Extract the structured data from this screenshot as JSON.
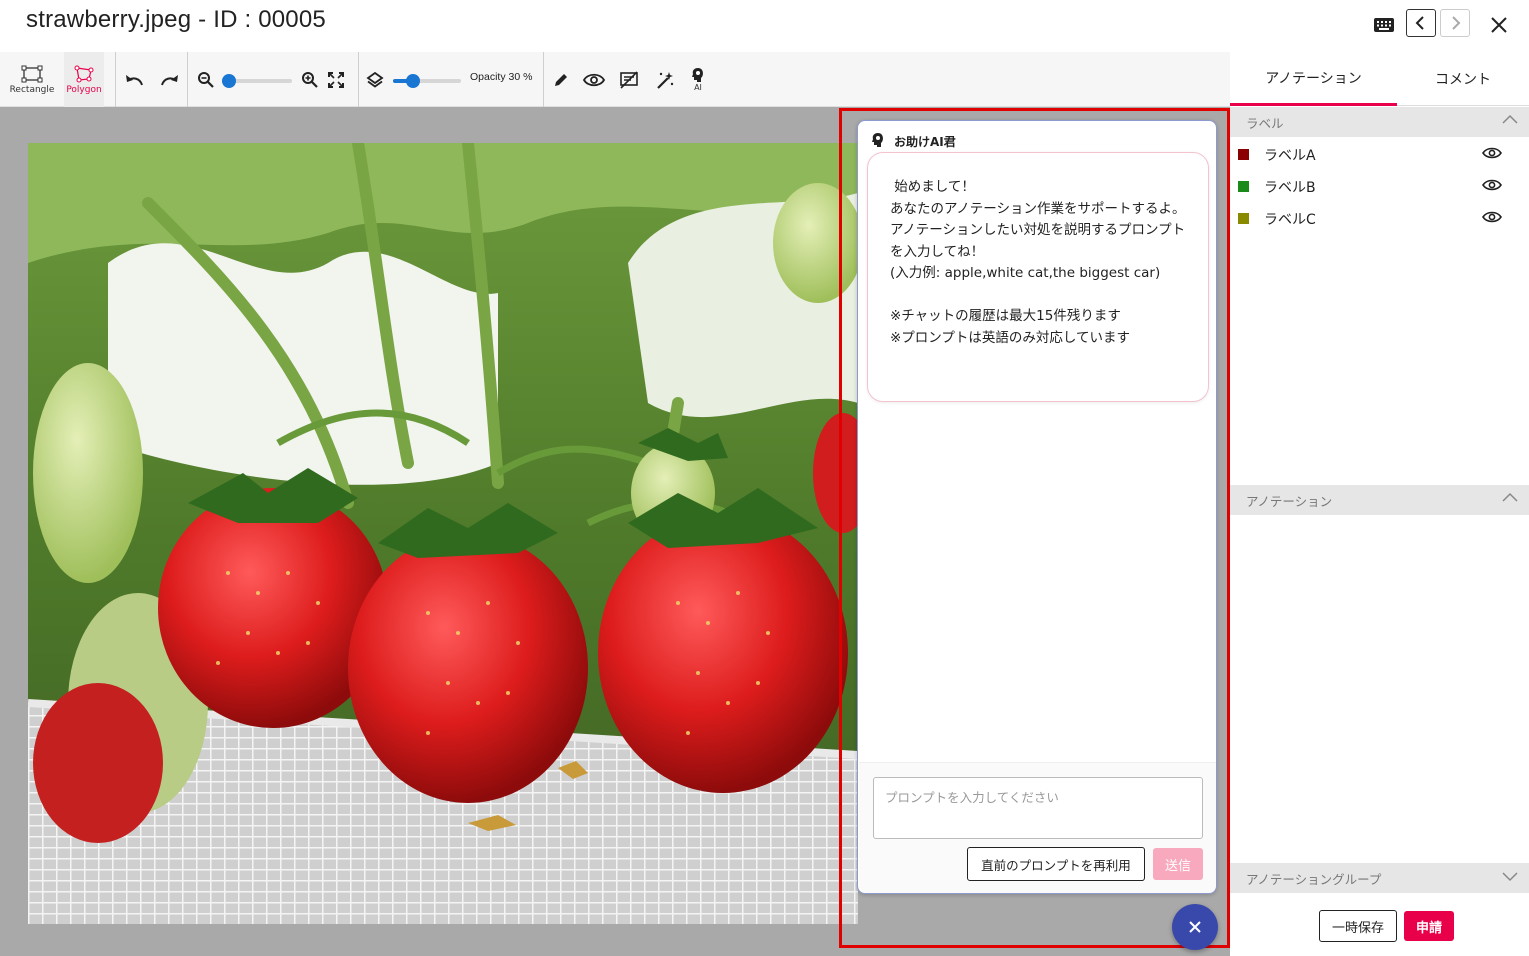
{
  "window": {
    "title": "strawberry.jpeg - ID : 00005"
  },
  "toolbar": {
    "rectangle_label": "Rectangle",
    "polygon_label": "Polygon",
    "opacity_label": "Opacity 30 %",
    "opacity_value": 0.3,
    "zoom_value": 0.05,
    "ai_label": "AI"
  },
  "chat": {
    "title": "お助けAI君",
    "message": " 始めまして！\nあなたのアノテーション作業をサポートするよ。\nアノテーションしたい対処を説明するプロンプトを入力してね！\n(入力例: apple,white cat,the biggest car)\n\n※チャットの履歴は最大15件残ります\n※プロンプトは英語のみ対応しています",
    "placeholder": "プロンプトを入力してください",
    "reuse_label": "直前のプロンプトを再利用",
    "send_label": "送信"
  },
  "sidebar": {
    "tabs": [
      {
        "label": "アノテーション",
        "active": true
      },
      {
        "label": "コメント",
        "active": false
      }
    ],
    "label_section": "ラベル",
    "labels": [
      {
        "name": "ラベルA",
        "color": "#8b0000"
      },
      {
        "name": "ラベルB",
        "color": "#1a8a1a"
      },
      {
        "name": "ラベルC",
        "color": "#8a8a00"
      }
    ],
    "annotation_section": "アノテーション",
    "group_section": "アノテーショングループ",
    "save_label": "一時保存",
    "submit_label": "申請"
  },
  "colors": {
    "accent": "#e8004a",
    "highlight": "#e00000",
    "fab": "#3949ab",
    "slider": "#1976d2"
  }
}
